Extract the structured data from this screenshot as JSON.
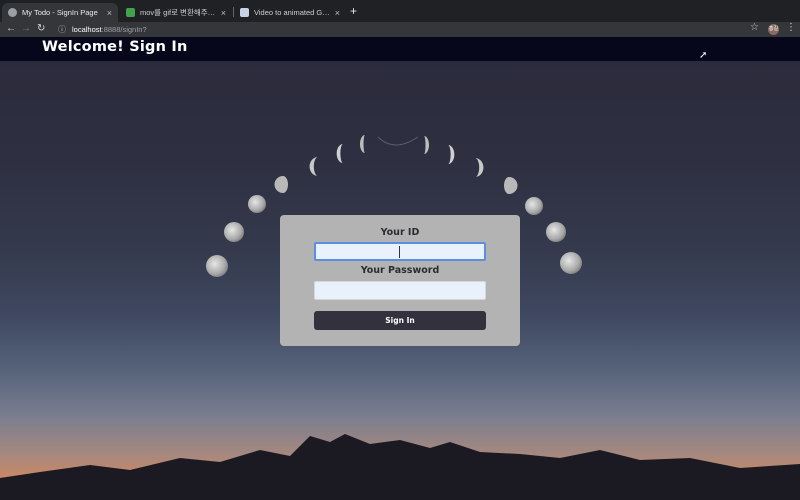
{
  "browser": {
    "tabs": [
      {
        "title": "My Todo - SignIn Page",
        "active": true
      },
      {
        "title": "mov를 gif로 변환해주는 사이트 (..",
        "active": false
      },
      {
        "title": "Video to animated GIF converte",
        "active": false
      }
    ],
    "new_tab_symbol": "+",
    "url_host": "localhost",
    "url_rest": ":8888/signIn?",
    "profile_initials": "홍길"
  },
  "header": {
    "title": "Welcome! Sign In"
  },
  "form": {
    "id_label": "Your ID",
    "id_value": "",
    "password_label": "Your Password",
    "password_value": "",
    "submit_label": "Sign In"
  },
  "colors": {
    "header_bg": "#06071a",
    "card_bg": "#b3b3b3",
    "button_bg": "#33313d",
    "focus_border": "#5b8ee0"
  }
}
